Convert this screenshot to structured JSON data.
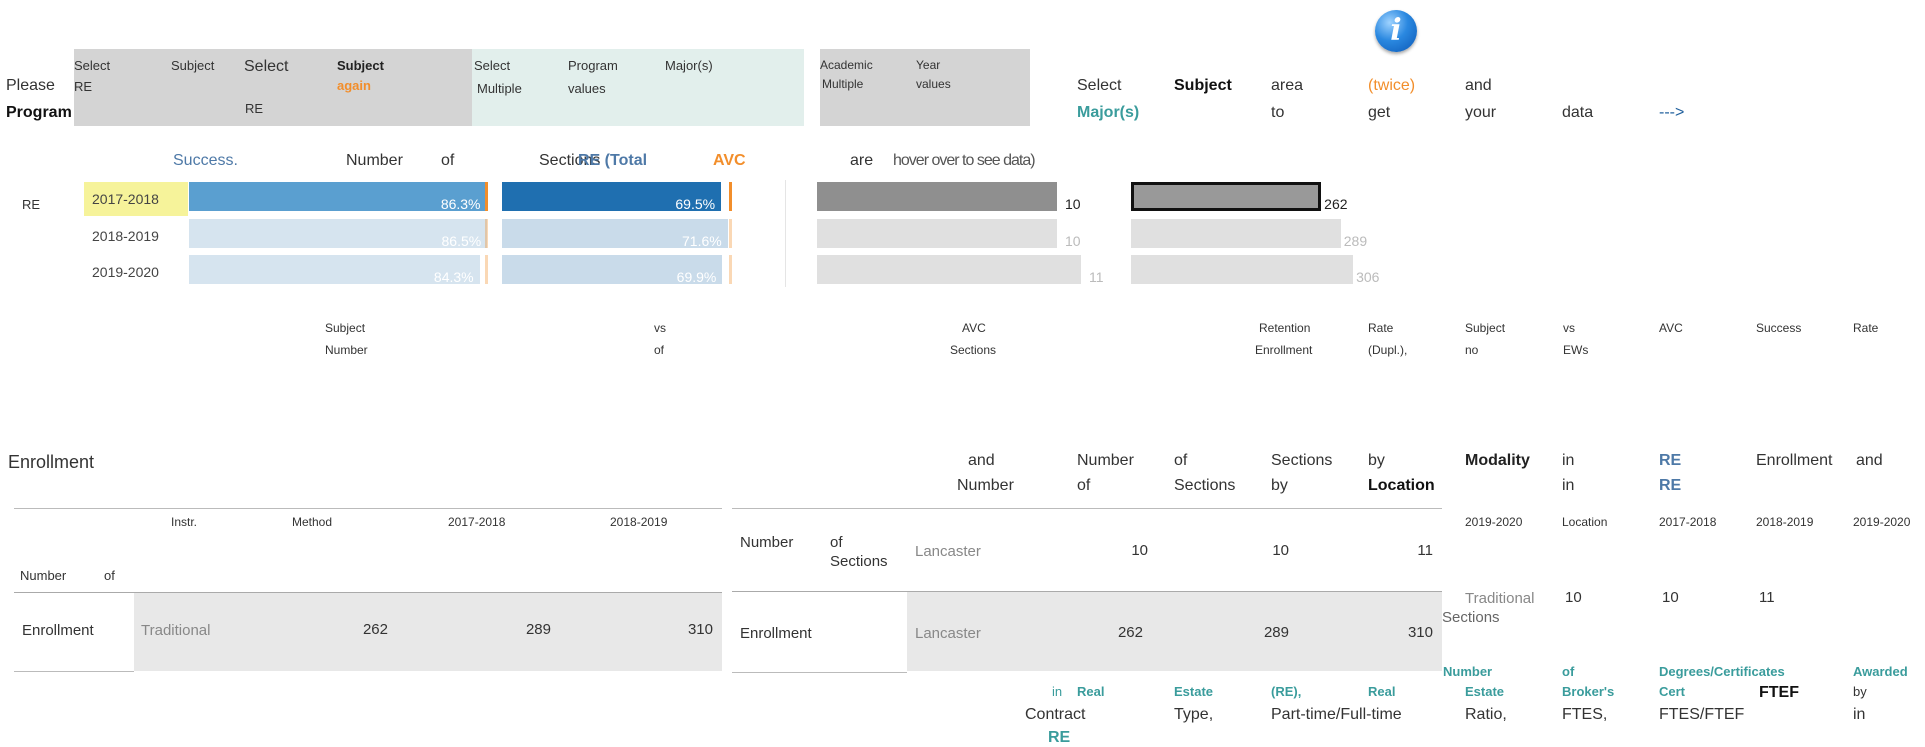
{
  "filters": {
    "program": {
      "line1": "Please",
      "line2": "Program"
    },
    "box1": {
      "select": "Select",
      "re": "RE",
      "subject": "Subject",
      "select2": "Select",
      "subject_again": "Subject",
      "again": "again",
      "re2": "RE"
    },
    "box2": {
      "select": "Select",
      "multiple": "Multiple",
      "program": "Program",
      "values": "values",
      "majors": "Major(s)"
    },
    "box3": {
      "academic": "Academic",
      "multiple": "Multiple",
      "year": "Year",
      "values": "values"
    }
  },
  "instruction": {
    "w": [
      "Select",
      "Subject",
      "area",
      "(twice)",
      "and",
      "Major(s)",
      "to",
      "get",
      "your",
      "data",
      "--->"
    ]
  },
  "title_row": {
    "success": "Success.",
    "number": "Number",
    "of": "of",
    "sections": "Sections",
    "re_total": "RE (Total",
    "avc": "AVC",
    "are": "are",
    "hover": "hover over to see data)"
  },
  "chart": {
    "row_label": "RE",
    "years": [
      "2017-2018",
      "2018-2019",
      "2019-2020"
    ],
    "success_rate": [
      86.3,
      86.5,
      84.3
    ],
    "success_labels": [
      "86.3%",
      "86.5%",
      "84.3%"
    ],
    "retention_rate": [
      69.5,
      71.6,
      69.9
    ],
    "retention_labels": [
      "69.5%",
      "71.6%",
      "69.9%"
    ],
    "sections": [
      10,
      10,
      11
    ],
    "enrollment": [
      262,
      289,
      306
    ],
    "colors": {
      "success": "#5a9fd0",
      "retention": "#1f6fb0",
      "faded_success": "#d6e4ef",
      "faded_retention": "#c9dbea",
      "count": "#8f8f8f",
      "faded_count": "#e0e0e0",
      "tick": "#f28e2b",
      "highlight": "#f6f39a"
    }
  },
  "captions": {
    "c1": "Subject",
    "c2": "Number",
    "c3": "vs",
    "c4": "of",
    "c5": "AVC",
    "c6": "Sections",
    "c7": "Retention",
    "c8": "Enrollment",
    "c9": "Rate",
    "c10": "(Dupl.),",
    "c11": "Subject",
    "c12": "no",
    "c13": "vs",
    "c14": "EWs",
    "c15": "AVC",
    "c16": "Success",
    "c17": "Rate"
  },
  "table1": {
    "title": "Enrollment",
    "headers": [
      "Instr.",
      "Method",
      "2017-2018",
      "2018-2019"
    ],
    "row_number_label": [
      "Number",
      "of"
    ],
    "row": {
      "label": "Enrollment",
      "method": "Traditional",
      "v1": "262",
      "v2": "289",
      "v3": "310"
    }
  },
  "table2": {
    "header_words": [
      "and",
      "Number",
      "Number",
      "of",
      "of",
      "Sections",
      "Sections",
      "by",
      "by",
      "Location"
    ],
    "rows": [
      {
        "label": "Number",
        "label2": "of",
        "label3": "Sections",
        "loc": "Lancaster",
        "v1": "10",
        "v2": "10",
        "v3": "11"
      },
      {
        "label": "Enrollment",
        "loc": "Lancaster",
        "v1": "262",
        "v2": "289",
        "v3": "310"
      }
    ]
  },
  "table3": {
    "header_words": [
      "Modality",
      "in",
      "in",
      "RE",
      "RE",
      "Enrollment",
      "and"
    ],
    "col_headers": [
      "2019-2020",
      "Location",
      "2017-2018",
      "2018-2019",
      "2019-2020"
    ],
    "row": {
      "label": "Traditional",
      "label2": "Sections",
      "v1": "10",
      "v2": "10",
      "v3": "11"
    }
  },
  "footer": {
    "w1": "in",
    "w2": "Real",
    "w3": "Estate",
    "w4": "(RE),",
    "w5": "Real",
    "w6": "Number",
    "w7": "Estate",
    "w8": "of",
    "w9": "Broker's",
    "w10": "Degrees/Certificates",
    "w11": "Cert",
    "w12": "Awarded",
    "w13": "by",
    "w14": "Contract",
    "w15": "RE",
    "w16": "Type,",
    "w17": "Part-time/Full-time",
    "w18": "Ratio,",
    "w19": "FTES,",
    "w20": "FTES/FTEF",
    "w21": "FTEF",
    "w22": "in"
  }
}
